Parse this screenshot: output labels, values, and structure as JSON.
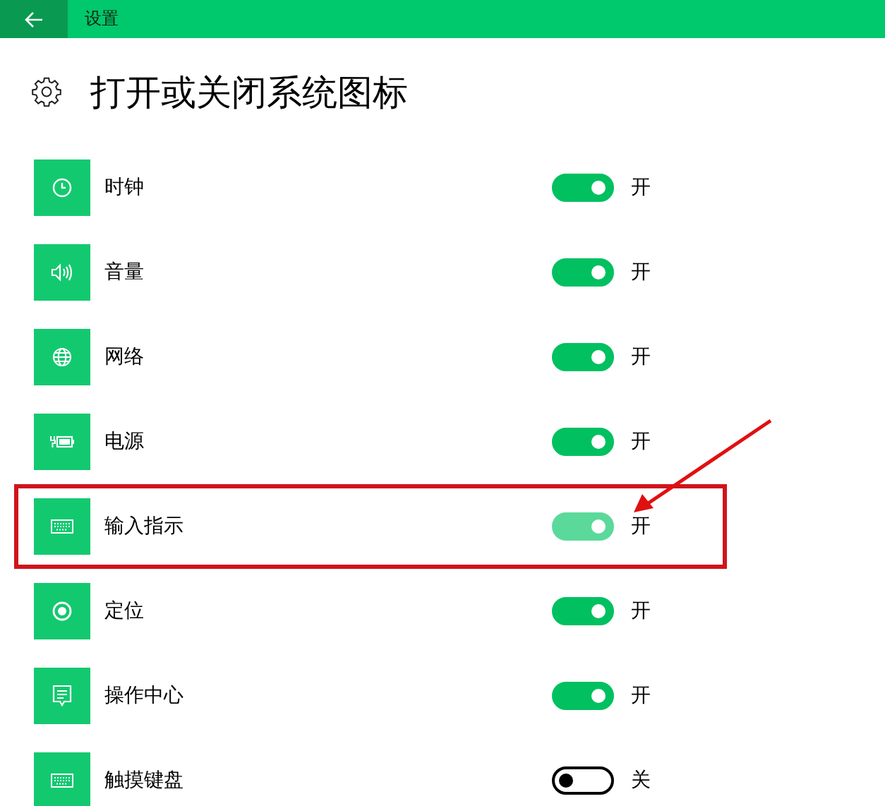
{
  "header": {
    "title": "设置"
  },
  "page": {
    "title": "打开或关闭系统图标"
  },
  "items": [
    {
      "kind": "clock",
      "label": "时钟",
      "on": true,
      "disabled": false,
      "highlighted": false,
      "state_label": "开"
    },
    {
      "kind": "volume",
      "label": "音量",
      "on": true,
      "disabled": false,
      "highlighted": false,
      "state_label": "开"
    },
    {
      "kind": "network",
      "label": "网络",
      "on": true,
      "disabled": false,
      "highlighted": false,
      "state_label": "开"
    },
    {
      "kind": "power",
      "label": "电源",
      "on": true,
      "disabled": false,
      "highlighted": false,
      "state_label": "开"
    },
    {
      "kind": "keyboard",
      "label": "输入指示",
      "on": true,
      "disabled": true,
      "highlighted": true,
      "state_label": "开"
    },
    {
      "kind": "location",
      "label": "定位",
      "on": true,
      "disabled": false,
      "highlighted": false,
      "state_label": "开"
    },
    {
      "kind": "action",
      "label": "操作中心",
      "on": true,
      "disabled": false,
      "highlighted": false,
      "state_label": "开"
    },
    {
      "kind": "keyboard",
      "label": "触摸键盘",
      "on": false,
      "disabled": false,
      "highlighted": false,
      "state_label": "关"
    }
  ]
}
